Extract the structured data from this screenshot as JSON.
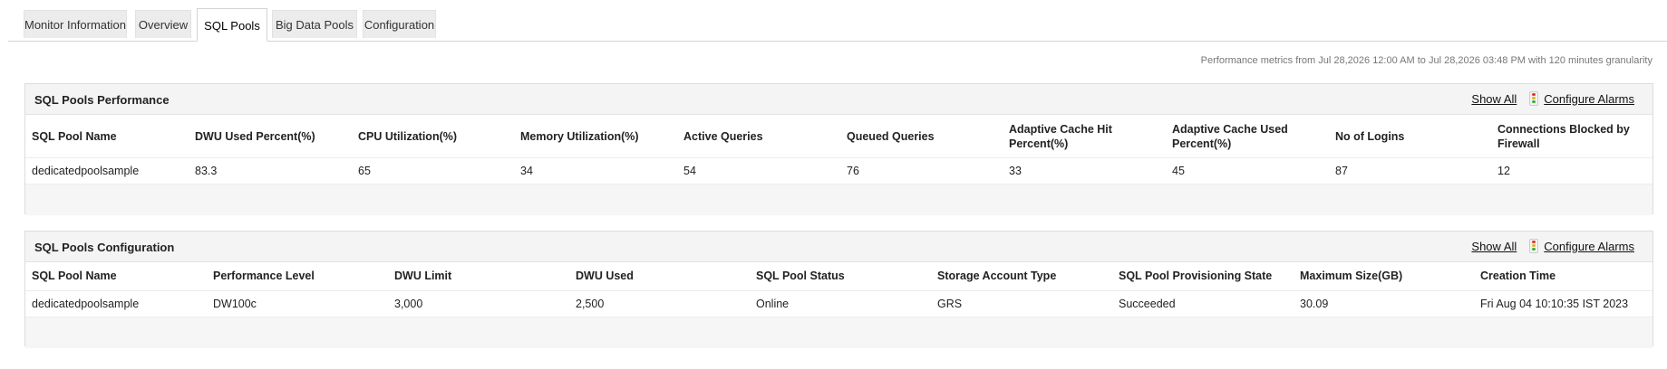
{
  "tabs": [
    {
      "label": "Monitor Information"
    },
    {
      "label": "Overview"
    },
    {
      "label": "SQL Pools"
    },
    {
      "label": "Big Data Pools"
    },
    {
      "label": "Configuration"
    }
  ],
  "active_tab": "SQL Pools",
  "metrics_note": "Performance metrics from Jul 28,2026 12:00 AM to Jul 28,2026 03:48 PM with 120 minutes granularity",
  "performance": {
    "title": "SQL Pools Performance",
    "show_all": "Show All",
    "configure_alarms": "Configure Alarms",
    "columns": [
      "SQL Pool Name",
      "DWU Used Percent(%)",
      "CPU Utilization(%)",
      "Memory Utilization(%)",
      "Active Queries",
      "Queued Queries",
      "Adaptive Cache Hit Percent(%)",
      "Adaptive Cache Used Percent(%)",
      "No of Logins",
      "Connections Blocked by Firewall"
    ],
    "rows": [
      [
        "dedicatedpoolsample",
        "83.3",
        "65",
        "34",
        "54",
        "76",
        "33",
        "45",
        "87",
        "12"
      ]
    ]
  },
  "configuration": {
    "title": "SQL Pools Configuration",
    "show_all": "Show All",
    "configure_alarms": "Configure Alarms",
    "columns": [
      "SQL Pool Name",
      "Performance Level",
      "DWU Limit",
      "DWU Used",
      "SQL Pool Status",
      "Storage Account Type",
      "SQL Pool Provisioning State",
      "Maximum Size(GB)",
      "Creation Time"
    ],
    "rows": [
      [
        "dedicatedpoolsample",
        "DW100c",
        "3,000",
        "2,500",
        "Online",
        "GRS",
        "Succeeded",
        "30.09",
        "Fri Aug 04 10:10:35 IST 2023"
      ]
    ]
  },
  "colors": {
    "alarm_red": "#d9362b",
    "alarm_yellow": "#e8b41a",
    "alarm_green": "#3aa844"
  },
  "icons": {
    "alarm": "traffic-light-icon"
  }
}
